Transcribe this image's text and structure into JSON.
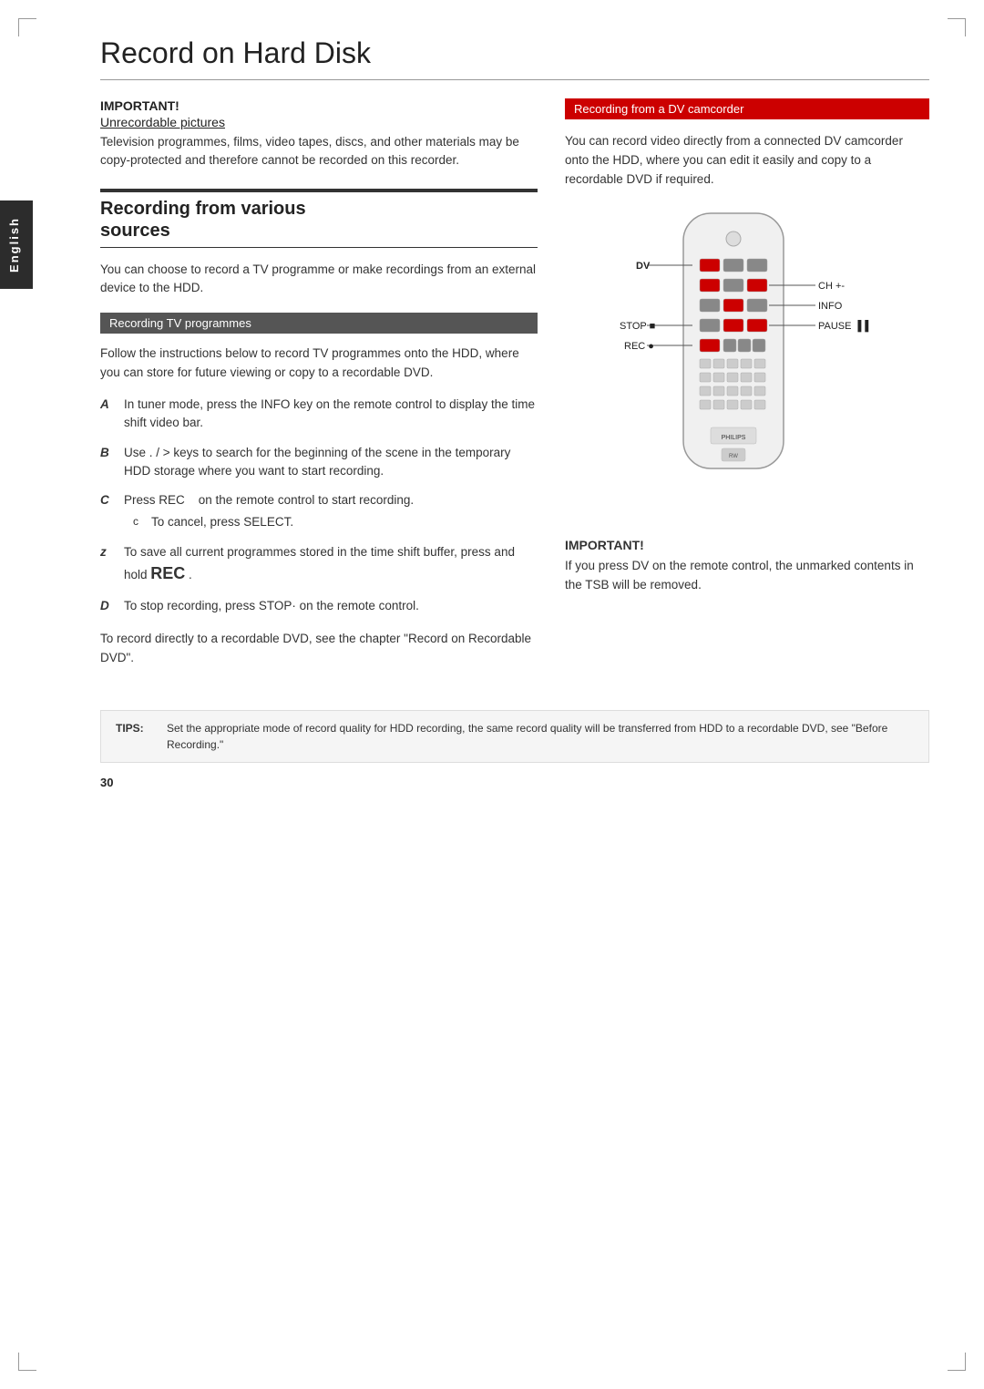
{
  "page": {
    "title": "Record on Hard Disk",
    "sidebar_label": "English",
    "page_number": "30"
  },
  "important_section": {
    "title": "IMPORTANT!",
    "subtitle": "Unrecordable pictures",
    "text": "Television programmes, films, video tapes, discs, and other materials may be copy-protected and therefore cannot be recorded on this recorder."
  },
  "recording_from_sources": {
    "heading_line1": "Recording from various",
    "heading_line2": "sources",
    "intro": "You can choose to record a TV programme or make recordings from an external device to the HDD."
  },
  "recording_tv": {
    "subsection_label": "Recording TV programmes",
    "text": "Follow the instructions below to record TV programmes onto the HDD, where you can store for future viewing or copy to a recordable DVD.",
    "steps": [
      {
        "label": "A",
        "text": "In tuner mode, press the INFO  key on the remote control to display the time shift video bar."
      },
      {
        "label": "B",
        "text": "Use .   / >    keys to search for the beginning of the scene in the temporary HDD storage where you want to start recording."
      },
      {
        "label": "C",
        "text": "Press REC    on the remote control to start recording.",
        "sub": {
          "label": "c",
          "text": "To cancel, press SELECT."
        }
      },
      {
        "label": "z",
        "text": "To save all current programmes stored in the time shift buffer, press and hold REC  ."
      },
      {
        "label": "D",
        "text": "To stop recording, press STOP·  on the remote control."
      }
    ],
    "dvd_note": "To record directly to a    recordable DVD, see the chapter \"Record on Recordable DVD\"."
  },
  "dv_camcorder": {
    "subsection_label": "Recording from a DV camcorder",
    "text": "You can record video directly from a connected DV camcorder onto the HDD, where you can edit it easily and copy to a recordable DVD if required."
  },
  "remote_labels": {
    "dv": "DV",
    "ch": "CH +-",
    "info": "INFO",
    "stop": "STOP ■",
    "pause": "PAUSE ▐▐",
    "rec": "REC ●"
  },
  "important_note": {
    "title": "IMPORTANT!",
    "text": "If you press DV on the remote control, the unmarked contents in the TSB will be removed."
  },
  "tips": {
    "label": "TIPS:",
    "text": "Set the appropriate mode of record quality for HDD recording, the same record quality will be transferred from HDD to a recordable DVD, see \"Before Recording.\""
  }
}
